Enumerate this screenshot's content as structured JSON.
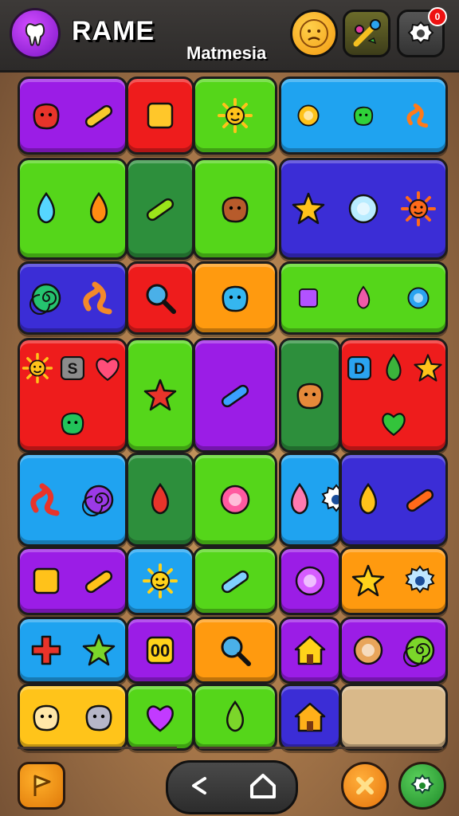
{
  "header": {
    "title": "RAME",
    "subtitle": "Matmesia",
    "notification_count": "0",
    "icons": [
      "tooth-icon",
      "face-icon",
      "candy-icon",
      "settings-icon"
    ]
  },
  "colors": {
    "purple": "#9b1de6",
    "red": "#ee1c1c",
    "green": "#55d61a",
    "dark_green": "#2d8f3c",
    "blue": "#1fa3f0",
    "indigo": "#3b2dd6",
    "orange": "#ff9a0f",
    "yellow": "#ffc41a",
    "empty": "#d9b98a"
  },
  "board": {
    "rows": [
      {
        "tiles": [
          {
            "color": "purple",
            "icons": [
              "red-monster-icon",
              "pencil-icon"
            ]
          },
          {
            "color": "red",
            "icons": [
              "cheese-block-icon"
            ]
          },
          {
            "color": "green",
            "icons": [
              "sun-icon"
            ]
          },
          {
            "color": "blue",
            "icons": [
              "lollipop-icon",
              "green-blob-icon",
              "rainbow-icon"
            ]
          }
        ]
      },
      {
        "tiles": [
          {
            "color": "green",
            "icons": [
              "racket-icon",
              "leaf-eye-icon"
            ]
          },
          {
            "color": "dark_green",
            "icons": [
              "banana-icon"
            ]
          },
          {
            "color": "green",
            "icons": [
              "dog-icon"
            ]
          },
          {
            "color": "indigo",
            "icons": [
              "stars-icon",
              "compass-icon",
              "spiky-sun-icon"
            ]
          }
        ]
      },
      {
        "tiles": [
          {
            "color": "indigo",
            "icons": [
              "swirl-candy-icon",
              "caterpillar-icon"
            ]
          },
          {
            "color": "red",
            "icons": [
              "magnifier-icon"
            ]
          },
          {
            "color": "orange",
            "icons": [
              "blue-cloud-icon"
            ]
          },
          {
            "color": "green",
            "icons": [
              "gem-icon",
              "pink-crystal-icon",
              "blue-disc-icon"
            ]
          }
        ]
      },
      {
        "tiles": [
          {
            "color": "red",
            "icons": [
              "sun-icon",
              "jar-icon",
              "flower-icon",
              "green-frog-icon"
            ]
          },
          {
            "color": "green",
            "icons": [
              "kite-icon"
            ]
          },
          {
            "color": "purple",
            "icons": [
              "pen-icon"
            ]
          },
          {
            "color": "dark_green",
            "icons": [
              "kangaroo-icon"
            ]
          },
          {
            "color": "red",
            "icons": [
              "letter-d-icon",
              "leaf-icon",
              "star-figure-icon",
              "green-heart-icon"
            ]
          }
        ]
      },
      {
        "tiles": [
          {
            "color": "blue",
            "icons": [
              "squiggle-icon",
              "purple-monster-icon"
            ]
          },
          {
            "color": "dark_green",
            "icons": [
              "strawberry-icon"
            ]
          },
          {
            "color": "green",
            "icons": [
              "beach-ball-icon"
            ]
          },
          {
            "color": "blue",
            "icons": [
              "pin-icon",
              "gear-icon"
            ]
          },
          {
            "color": "indigo",
            "icons": [
              "drill-icon",
              "exclamation-icon"
            ]
          }
        ]
      },
      {
        "tiles": [
          {
            "color": "purple",
            "icons": [
              "cube-icon",
              "bent-bar-icon"
            ]
          },
          {
            "color": "blue",
            "icons": [
              "smiley-icon"
            ]
          },
          {
            "color": "green",
            "icons": [
              "bottle-icon"
            ]
          },
          {
            "color": "purple",
            "icons": [
              "ring-icon"
            ]
          },
          {
            "color": "orange",
            "icons": [
              "star-icon",
              "sun-gear-icon"
            ]
          }
        ]
      },
      {
        "tiles": [
          {
            "color": "blue",
            "icons": [
              "red-cross-icon",
              "green-plane-icon"
            ]
          },
          {
            "color": "purple",
            "icons": [
              "yellow-face-icon"
            ]
          },
          {
            "color": "orange",
            "icons": [
              "magnifier-icon"
            ]
          },
          {
            "color": "purple",
            "icons": [
              "house-icon"
            ]
          },
          {
            "color": "purple",
            "icons": [
              "cookie-icon",
              "green-spiral-icon"
            ]
          }
        ]
      },
      {
        "tiles": [
          {
            "color": "yellow",
            "icons": [
              "cat-face-icon",
              "grey-cat-icon"
            ]
          },
          {
            "color": "green",
            "icons": [
              "heart-box-icon"
            ]
          },
          {
            "color": "green",
            "icons": [
              "cupcake-icon"
            ]
          },
          {
            "color": "indigo",
            "icons": [
              "shield-icon"
            ]
          },
          {
            "color": "empty",
            "icons": []
          }
        ]
      }
    ]
  },
  "footer": {
    "icons": [
      "flag-icon",
      "back-icon",
      "home-icon",
      "close-icon",
      "settings-icon"
    ]
  }
}
